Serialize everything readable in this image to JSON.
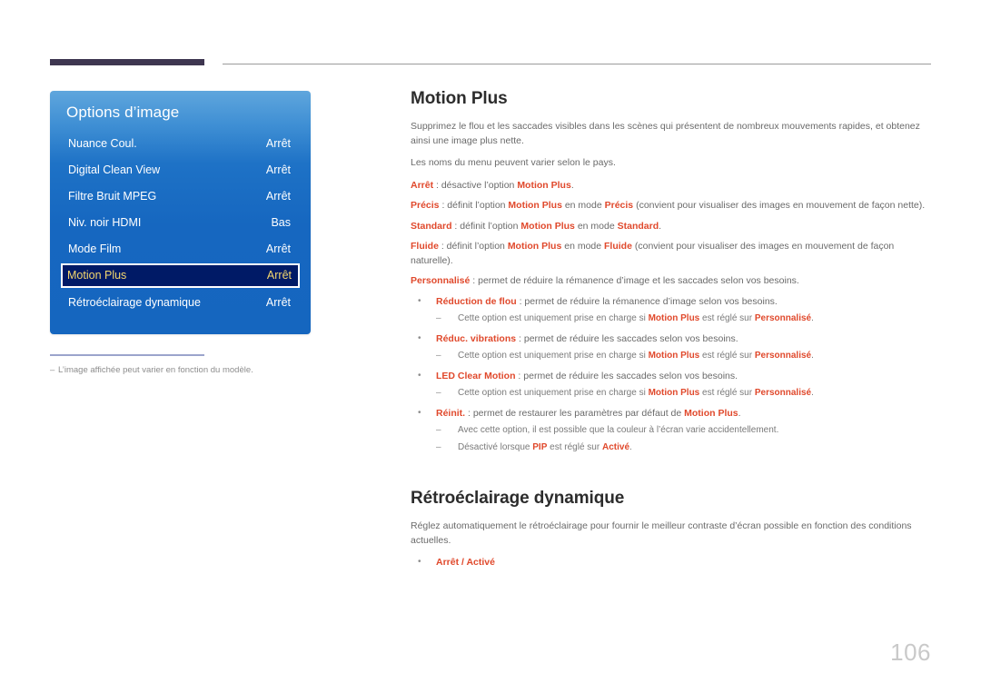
{
  "page": {
    "number": "106",
    "accent_color": "#e0492c",
    "osd_panel_blue": "#1667c0",
    "osd_selected_bg": "#001a66",
    "osd_selected_text": "#f5d76e",
    "header_bar_color": "#3e3650"
  },
  "osd": {
    "title": "Options d’image",
    "rows": [
      {
        "label": "Nuance Coul.",
        "value": "Arrêt",
        "selected": false
      },
      {
        "label": "Digital Clean View",
        "value": "Arrêt",
        "selected": false
      },
      {
        "label": "Filtre Bruit MPEG",
        "value": "Arrêt",
        "selected": false
      },
      {
        "label": "Niv. noir HDMI",
        "value": "Bas",
        "selected": false
      },
      {
        "label": "Mode Film",
        "value": "Arrêt",
        "selected": false
      },
      {
        "label": "Motion Plus",
        "value": "Arrêt",
        "selected": true
      },
      {
        "label": "Rétroéclairage dynamique",
        "value": "Arrêt",
        "selected": false
      }
    ]
  },
  "footnote": {
    "dash": "–",
    "text": "L’image affichée peut varier en fonction du modèle."
  },
  "article": {
    "motion_plus": {
      "title": "Motion Plus",
      "intro": "Supprimez le flou et les saccades visibles dans les scènes qui présentent de nombreux mouvements rapides, et obtenez ainsi une image plus nette.",
      "note": "Les noms du menu peuvent varier selon le pays.",
      "option_arret_name": "Arrêt",
      "option_arret_text_1": " : désactive l’option ",
      "option_arret_term": "Motion Plus",
      "option_arret_text_2": ".",
      "option_precis_name": "Précis",
      "option_precis_text_1": " : définit l’option ",
      "option_precis_term1": "Motion Plus",
      "option_precis_text_2": " en mode ",
      "option_precis_term2": "Précis",
      "option_precis_text_3": " (convient pour visualiser des images en mouvement de façon nette).",
      "option_standard_name": "Standard",
      "option_standard_text_1": " : définit l’option ",
      "option_standard_term1": "Motion Plus",
      "option_standard_text_2": " en mode ",
      "option_standard_term2": "Standard",
      "option_standard_text_3": ".",
      "option_fluide_name": "Fluide",
      "option_fluide_text_1": " : définit l’option ",
      "option_fluide_term1": "Motion Plus",
      "option_fluide_text_2": " en mode ",
      "option_fluide_term2": "Fluide",
      "option_fluide_text_3": " (convient pour visualiser des images en mouvement de façon naturelle).",
      "option_perso_name": "Personnalisé",
      "option_perso_text": " : permet de réduire la rémanence d’image et les saccades selon vos besoins.",
      "sub_items": [
        {
          "name": "Réduction de flou",
          "text": " : permet de réduire la rémanence d’image selon vos besoins.",
          "notes": [
            {
              "t1": "Cette option est uniquement prise en charge si ",
              "h1": "Motion Plus",
              "t2": " est réglé sur ",
              "h2": "Personnalisé",
              "t3": "."
            }
          ]
        },
        {
          "name": "Réduc. vibrations",
          "text": " : permet de réduire les saccades selon vos besoins.",
          "notes": [
            {
              "t1": "Cette option est uniquement prise en charge si ",
              "h1": "Motion Plus",
              "t2": " est réglé sur ",
              "h2": "Personnalisé",
              "t3": "."
            }
          ]
        },
        {
          "name": "LED Clear Motion",
          "text": " : permet de réduire les saccades selon vos besoins.",
          "notes": [
            {
              "t1": "Cette option est uniquement prise en charge si ",
              "h1": "Motion Plus",
              "t2": " est réglé sur ",
              "h2": "Personnalisé",
              "t3": "."
            }
          ]
        },
        {
          "name": "Réinit.",
          "text_1": " : permet de restaurer les paramètres par défaut de ",
          "term": "Motion Plus",
          "text_2": ".",
          "notes": [
            {
              "t1": "Avec cette option, il est possible que la couleur à l’écran varie accidentellement.",
              "h1": "",
              "t2": "",
              "h2": "",
              "t3": ""
            },
            {
              "t1": "Désactivé lorsque ",
              "h1": "PIP",
              "t2": " est réglé sur ",
              "h2": "Activé",
              "t3": "."
            }
          ]
        }
      ]
    },
    "backlight": {
      "title": "Rétroéclairage dynamique",
      "intro": "Réglez automatiquement le rétroéclairage pour fournir le meilleur contraste d’écran possible en fonction des conditions actuelles.",
      "options": "Arrêt / Activé"
    }
  }
}
